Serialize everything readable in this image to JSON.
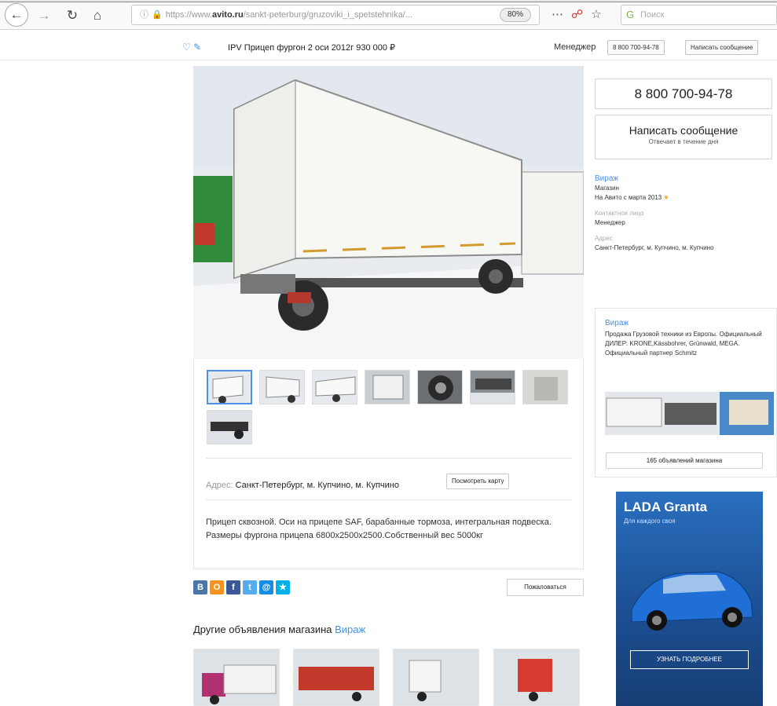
{
  "browser": {
    "url_prefix": "https://www.",
    "url_domain": "avito.ru",
    "url_path": "/sankt-peterburg/gruzoviki_i_spetstehnika/...",
    "zoom": "80%",
    "search_placeholder": "Поиск"
  },
  "sticky": {
    "title": "IPV Прицеп фургон 2 оси 2012г   930 000 ₽",
    "manager": "Менеджер",
    "phone_btn": "8 800 700-94-78",
    "message_btn": "Написать сообщение"
  },
  "listing": {
    "address_label": "Адрес:",
    "address": "Санкт-Петербург, м. Купчино, м. Купчино",
    "map_btn": "Посмотреть карту",
    "description": "Прицеп сквозной. Оси на прицепе SAF, барабанные тормоза, интегральная подвеска. Размеры фургона прицепа 6800х2500х2500.Собственный вес 5000кг",
    "report_btn": "Пожаловаться",
    "other_title": "Другие объявления магазина",
    "other_link": "Вираж"
  },
  "contact": {
    "phone": "8 800 700-94-78",
    "message_title": "Написать сообщение",
    "message_sub": "Отвечает в течение дня"
  },
  "seller": {
    "name": "Вираж",
    "type": "Магазин",
    "since": "На Авито с марта 2013",
    "contact_label": "Контактное лицо",
    "contact": "Менеджер",
    "address_label": "Адрес",
    "address": "Санкт-Петербург, м. Купчино, м. Купчино"
  },
  "store": {
    "name": "Вираж",
    "description": "Продажа Грузовой техники из Европы. Официальный ДИЛЕР: KRONE,Kässbohrer, Grünwald, MEGA. Официальный партнер Schmitz",
    "listings_btn": "165 объявлений магазина"
  },
  "ad": {
    "title": "LADA Granta",
    "subtitle": "Для каждого своя",
    "cta": "УЗНАТЬ ПОДРОБНЕЕ"
  },
  "social": [
    "В",
    "O",
    "f",
    "t",
    "@",
    "★"
  ],
  "colors": {
    "link": "#4a90e2",
    "active_thumb": "#4c91e6",
    "vk": "#4a76a8",
    "ok": "#f7931e",
    "fb": "#3b5998",
    "tw": "#55acee",
    "mm": "#168de2",
    "lj": "#00b0ea"
  }
}
